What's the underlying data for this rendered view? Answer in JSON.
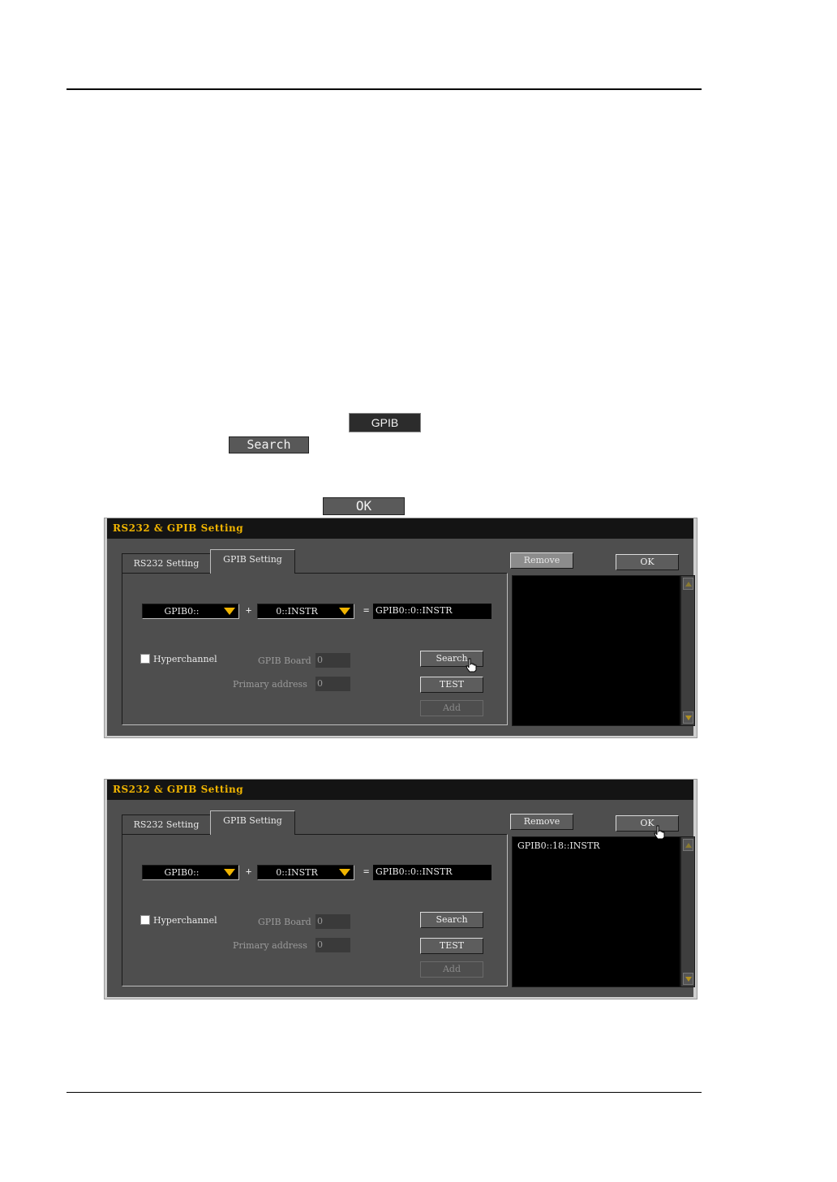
{
  "inline": {
    "gpib_label": "GPIB",
    "search_label": "Search",
    "ok_label": "OK"
  },
  "dialogs": [
    {
      "title": "RS232 & GPIB Setting",
      "tabs": [
        "RS232 Setting",
        "GPIB Setting"
      ],
      "board_combo": "GPIB0::",
      "address_combo": "0::INSTR",
      "plus": "+",
      "equals": "=",
      "resource": "GPIB0::0::INSTR",
      "hyperchannel_label": "Hyperchannel",
      "gpib_board_label": "GPIB Board",
      "gpib_board_value": "0",
      "primary_address_label": "Primary address",
      "primary_address_value": "0",
      "search_label": "Search",
      "test_label": "TEST",
      "add_label": "Add",
      "remove_label": "Remove",
      "ok_label": "OK",
      "list_items": []
    },
    {
      "title": "RS232 & GPIB Setting",
      "tabs": [
        "RS232 Setting",
        "GPIB Setting"
      ],
      "board_combo": "GPIB0::",
      "address_combo": "0::INSTR",
      "plus": "+",
      "equals": "=",
      "resource": "GPIB0::0::INSTR",
      "hyperchannel_label": "Hyperchannel",
      "gpib_board_label": "GPIB Board",
      "gpib_board_value": "0",
      "primary_address_label": "Primary address",
      "primary_address_value": "0",
      "search_label": "Search",
      "test_label": "TEST",
      "add_label": "Add",
      "remove_label": "Remove",
      "ok_label": "OK",
      "list_items": [
        "GPIB0::18::INSTR"
      ]
    }
  ],
  "colors": {
    "title_text": "#f0b400",
    "dialog_bg": "#4e4e4e",
    "list_bg": "#000000"
  },
  "icons": [
    "hand-cursor-icon",
    "dropdown-arrow-icon",
    "scroll-up-icon",
    "scroll-down-icon",
    "checkbox-icon"
  ]
}
